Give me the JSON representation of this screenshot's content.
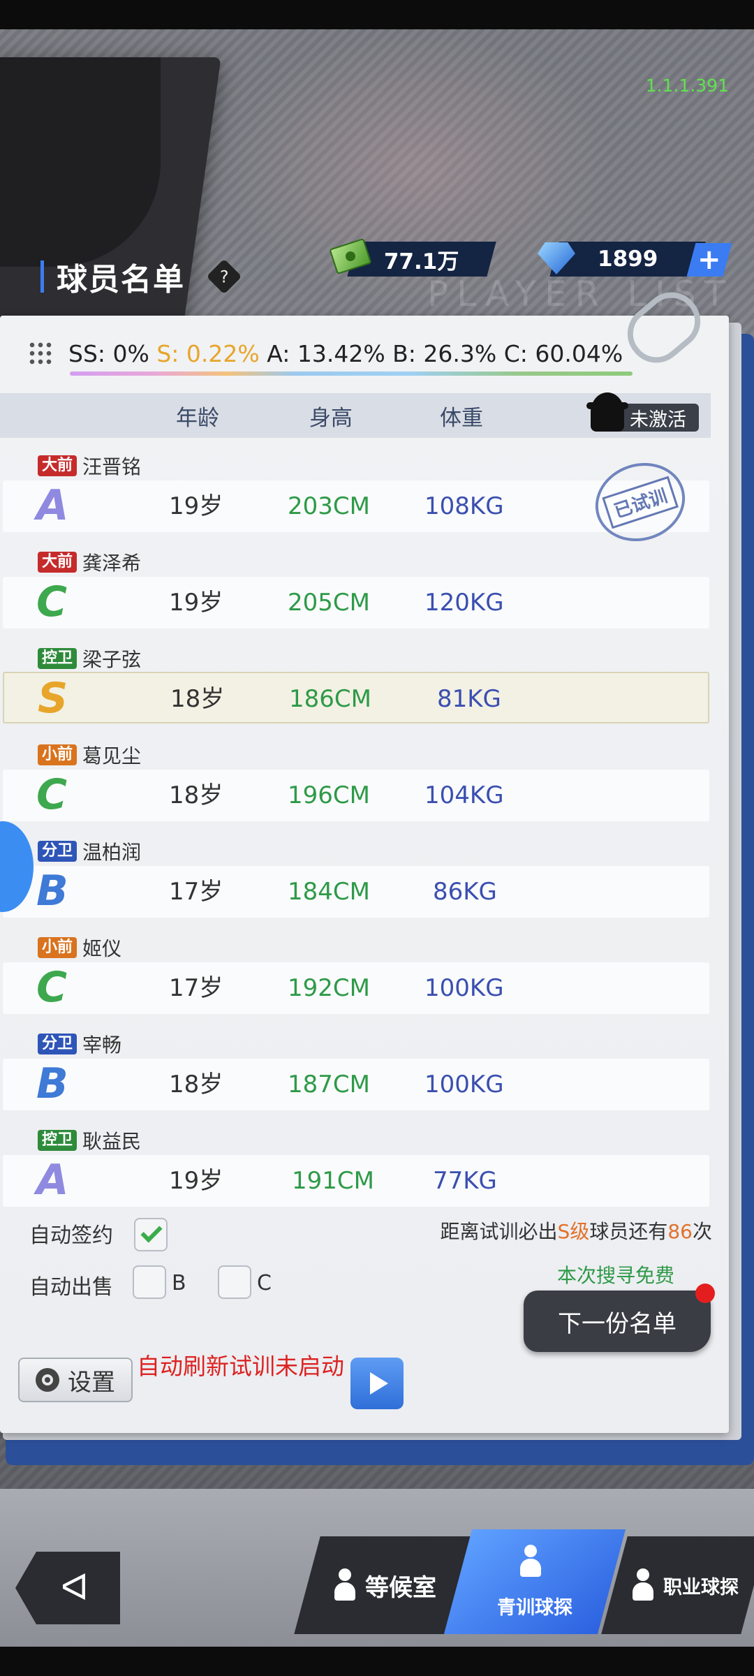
{
  "version": "1.1.1.391",
  "header": {
    "title": "球员名单",
    "help": "?",
    "ghost_text": "PLAYER LIST",
    "money": "77.1万",
    "gems": "1899",
    "plus": "+"
  },
  "distribution": {
    "ss": "SS: 0%",
    "s": "S: 0.22%",
    "rest": "A: 13.42% B: 26.3% C: 60.04%"
  },
  "table": {
    "headers": {
      "age": "年龄",
      "height": "身高",
      "weight": "体重"
    },
    "inactive": "未激活",
    "stamp": "已试训",
    "players": [
      {
        "pos": "大前",
        "name": "汪晋铭",
        "grade": "A",
        "age": "19岁",
        "height": "203CM",
        "weight": "108KG"
      },
      {
        "pos": "大前",
        "name": "龚泽希",
        "grade": "C",
        "age": "19岁",
        "height": "205CM",
        "weight": "120KG"
      },
      {
        "pos": "控卫",
        "name": "梁子弦",
        "grade": "S",
        "age": "18岁",
        "height": "186CM",
        "weight": "81KG"
      },
      {
        "pos": "小前",
        "name": "葛见尘",
        "grade": "C",
        "age": "18岁",
        "height": "196CM",
        "weight": "104KG"
      },
      {
        "pos": "分卫",
        "name": "温柏润",
        "grade": "B",
        "age": "17岁",
        "height": "184CM",
        "weight": "86KG"
      },
      {
        "pos": "小前",
        "name": "姬仪",
        "grade": "C",
        "age": "17岁",
        "height": "192CM",
        "weight": "100KG"
      },
      {
        "pos": "分卫",
        "name": "宰畅",
        "grade": "B",
        "age": "18岁",
        "height": "187CM",
        "weight": "100KG"
      },
      {
        "pos": "控卫",
        "name": "耿益民",
        "grade": "A",
        "age": "19岁",
        "height": "191CM",
        "weight": "77KG"
      }
    ]
  },
  "options": {
    "auto_sign": "自动签约",
    "auto_sell": "自动出售",
    "sell_b": "B",
    "sell_c": "C",
    "auto_sign_checked": true
  },
  "remain": {
    "pre": "距离试训必出",
    "grade": "S级",
    "mid": "球员还有",
    "count": "86",
    "post": "次"
  },
  "free_text": "本次搜寻免费",
  "next_button": "下一份名单",
  "settings_button": "设置",
  "auto_refresh_text": "自动刷新试训未启动",
  "nav": {
    "back": "ᐊ",
    "waiting_room": "等候室",
    "youth_scout": "青训球探",
    "pro_scout": "职业球探"
  },
  "colors": {
    "accent_blue": "#3b7cf2",
    "version_green": "#5ee34c",
    "grade_s": "#e7a52a",
    "alert_red": "#dd2222"
  }
}
